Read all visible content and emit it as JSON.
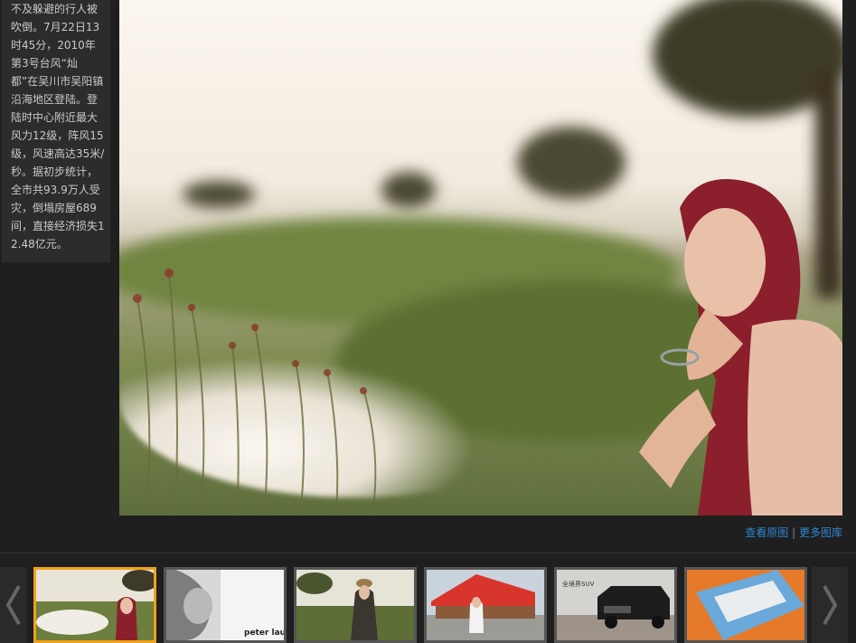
{
  "description": {
    "text": "不及躲避的行人被吹倒。7月22日13时45分，2010年第3号台风“灿都”在吴川市吴阳镇沿海地区登陆。登陆时中心附近最大风力12级，阵风15级，风速高达35米/秒。据初步统计，全市共93.9万人受灾，倒塌房屋689间，直接经济损失12.48亿元。"
  },
  "links": {
    "view_original": "查看原图",
    "separator": " | ",
    "more_galleries": "更多图库"
  },
  "thumbnails": [
    {
      "caption": "",
      "active": true
    },
    {
      "caption": "peter lau",
      "active": false
    },
    {
      "caption": "",
      "active": false
    },
    {
      "caption": "",
      "active": false
    },
    {
      "caption": "全境界SUV",
      "active": false
    },
    {
      "caption": "",
      "active": false
    }
  ],
  "colors": {
    "accent_active_border": "#f0a21a",
    "link": "#2e86d1"
  }
}
